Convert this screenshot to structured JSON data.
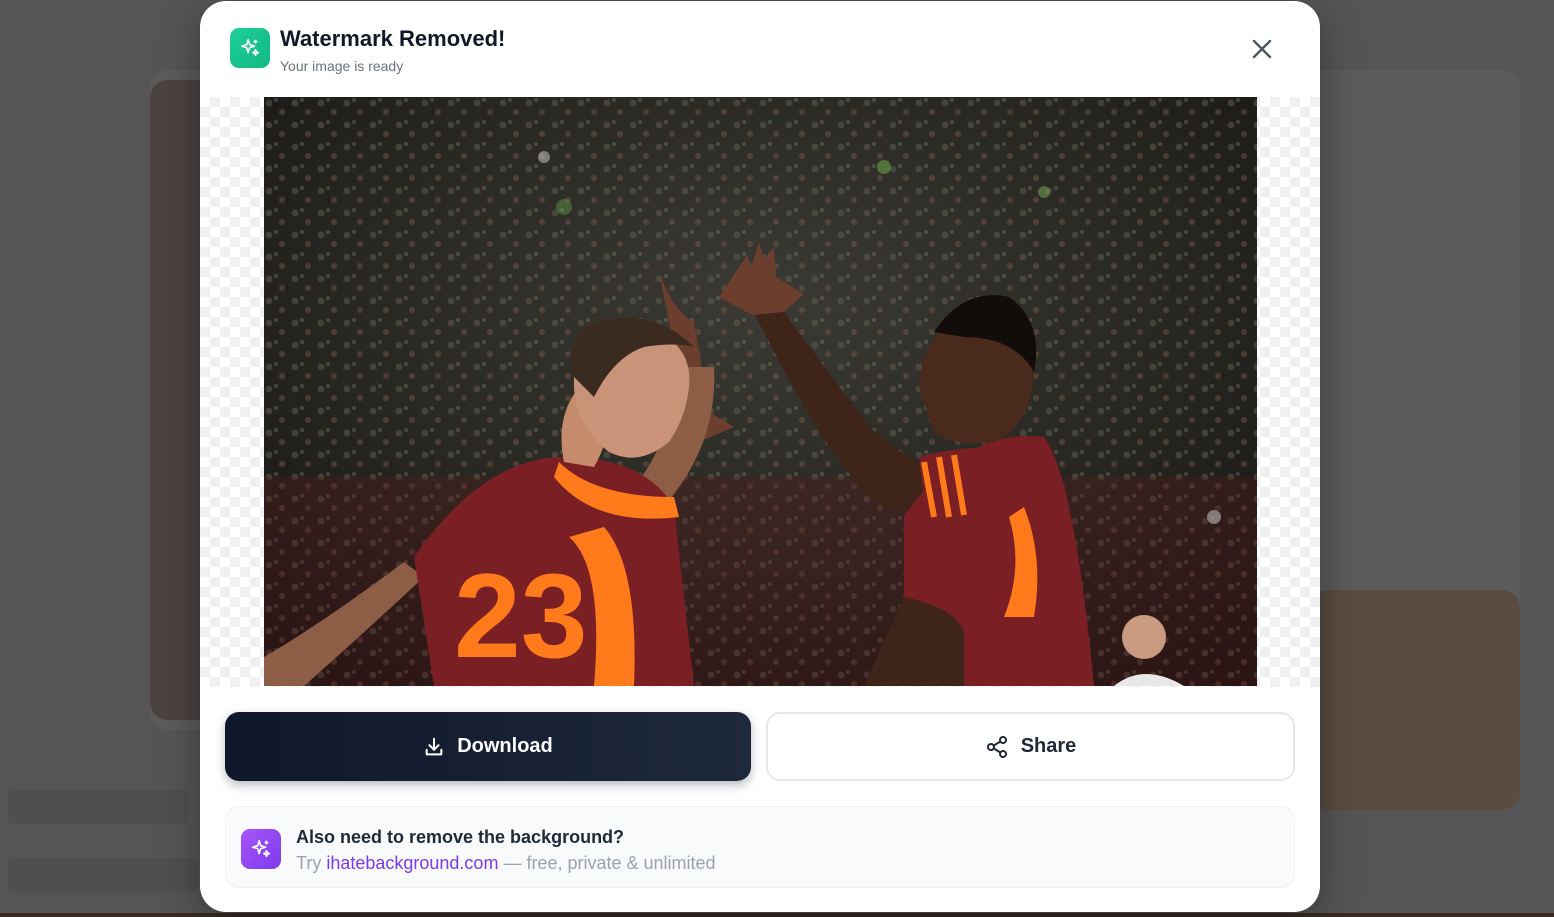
{
  "modal": {
    "title": "Watermark Removed!",
    "subtitle": "Your image is ready",
    "accent_color": "#10b981",
    "close_icon": "close-icon",
    "badge_icon": "sparkles-icon"
  },
  "preview": {
    "image_icon": "football-players-high-five-photo"
  },
  "actions": {
    "download_label": "Download",
    "download_icon": "download-icon",
    "share_label": "Share",
    "share_icon": "share-icon",
    "download_color": "#0f172a"
  },
  "promo": {
    "title": "Also need to remove the background?",
    "prefix": "Try ",
    "link_text": "ihatebackground.com",
    "suffix": " — free, private & unlimited",
    "icon": "sparkles-icon",
    "accent_color": "#7c3aed"
  }
}
